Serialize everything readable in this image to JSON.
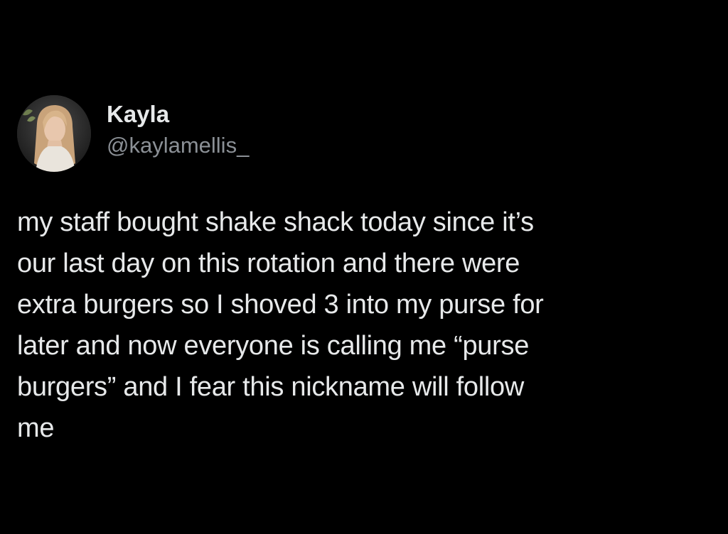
{
  "tweet": {
    "author": {
      "display_name": "Kayla",
      "handle": "@kaylamellis_",
      "avatar_icon": "profile-photo"
    },
    "text_lines": [
      "my staff bought shake shack today since it’s",
      "our last day on this rotation and there were",
      "extra burgers so I shoved 3 into my purse for",
      "later and now everyone is calling me “purse",
      "burgers” and I fear this nickname will follow",
      "me"
    ]
  },
  "colors": {
    "background": "#000000",
    "primary_text": "#e7e9ea",
    "secondary_text": "#8b9096"
  }
}
